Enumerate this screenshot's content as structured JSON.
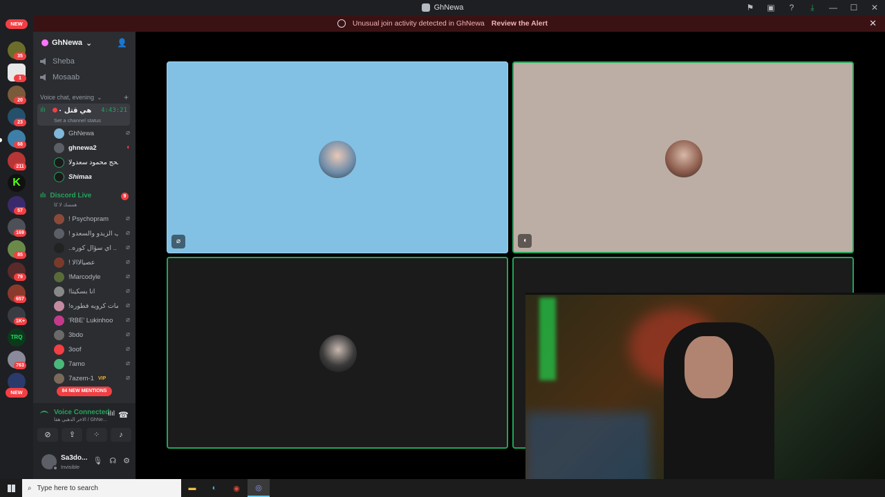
{
  "titlebar": {
    "title": "GhNewa"
  },
  "alert": {
    "message": "Unusual join activity detected in GhNewa",
    "action": "Review the Alert"
  },
  "guilds": {
    "new_top": "NEW",
    "new_bottom": "NEW",
    "badges": [
      "35",
      "1",
      "20",
      "23",
      "68",
      "211",
      "57",
      "169",
      "85",
      "79",
      "657",
      "1K+",
      "763"
    ]
  },
  "server": {
    "name": "GhNewa"
  },
  "channels": {
    "text_1": "Sheba",
    "text_2": "Mosaab",
    "category": "Voice chat, evening",
    "active_voice": {
      "name": "هي قتل ٠",
      "time": "4:43:21",
      "status": "Set a channel status"
    },
    "active_members": [
      "GhNewa",
      "ghnewa2",
      "الحج محمود سعدولا",
      "Shimaa"
    ],
    "live_category": "Discord Live",
    "live_count": "9",
    "live_sub": "همسك لا كا",
    "live_members": [
      "! Psychopram",
      "! بحب الزيدو والسعدو",
      "..اي سؤال كوره ..",
      "! عصيالاالا",
      "!Marcodyle",
      "!انا بسكيتا",
      "!اومات كرويه فطوره",
      "'RBE' Lukinhoo",
      "3bdo",
      "3oof",
      "7amo",
      "7azem-1"
    ],
    "vip_label": "VIP",
    "mentions": "84 NEW MENTIONS"
  },
  "voice": {
    "status": "Voice Connected",
    "sub": "الاخر الدهبي هقا / GhNe..."
  },
  "user": {
    "name": "Sa3do...",
    "status": "Invisible"
  },
  "taskbar": {
    "search_placeholder": "Type here to search"
  }
}
